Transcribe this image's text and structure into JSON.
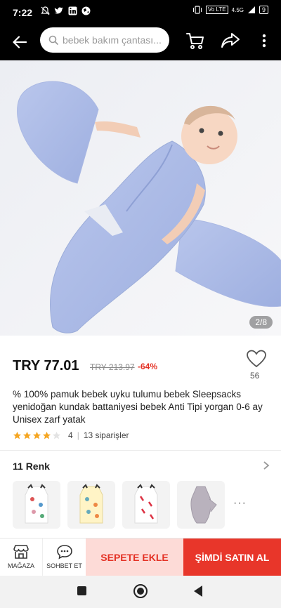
{
  "status_bar": {
    "time": "7:22",
    "battery": "9",
    "network": "4.5G"
  },
  "search": {
    "placeholder": "bebek bakım çantası..."
  },
  "icons": {
    "back": "arrow-left-icon",
    "search": "search-icon",
    "cart": "cart-icon",
    "share": "share-icon",
    "more": "more-vertical-icon",
    "wishlist": "heart-icon"
  },
  "gallery": {
    "pager": "2/8"
  },
  "product": {
    "price": "TRY 77.01",
    "old_price": "TRY 213.97",
    "discount": "-64%",
    "wish_count": "56",
    "title": "% 100% pamuk bebek uyku tulumu bebek Sleepsacks yenidoğan kundak battaniyesi bebek Anti Tipi yorgan 0-6 ay Unisex zarf yatak",
    "rating": 4,
    "rating_text": "4",
    "orders": "13 siparişler"
  },
  "colors": {
    "title": "11 Renk",
    "more": "···"
  },
  "actions": {
    "store_label": "MAĞAZA",
    "chat_label": "SOHBET ET",
    "add_cart": "SEPETE EKLE",
    "buy_now": "ŞİMDİ SATIN AL"
  },
  "theme": {
    "accent": "#e8362a",
    "accent_light": "#fddbd7",
    "star": "#f5a623"
  }
}
